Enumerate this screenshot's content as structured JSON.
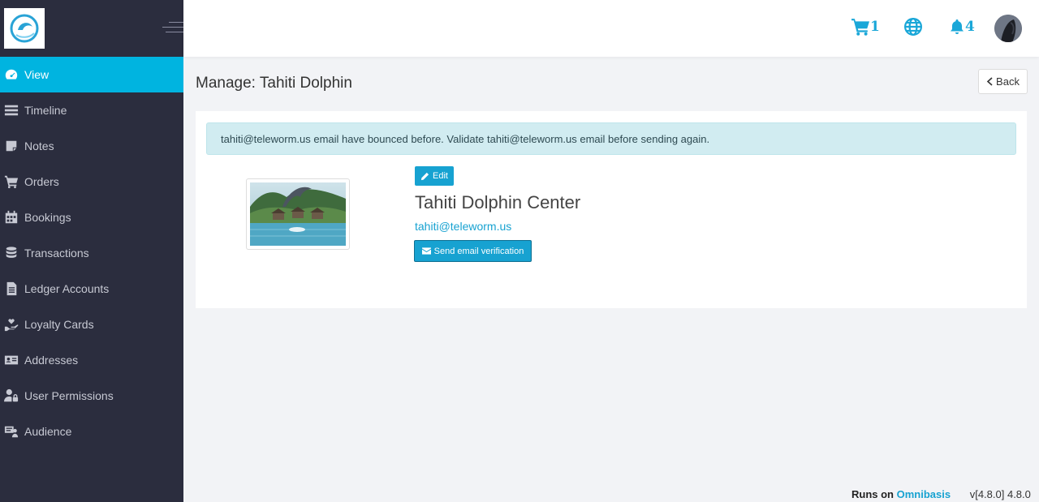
{
  "sidebar": {
    "items": [
      {
        "label": "View",
        "icon": "dashboard-gauge-icon",
        "active": true
      },
      {
        "label": "Timeline",
        "icon": "list-lines-icon"
      },
      {
        "label": "Notes",
        "icon": "sticky-note-icon"
      },
      {
        "label": "Orders",
        "icon": "shopping-cart-icon"
      },
      {
        "label": "Bookings",
        "icon": "calendar-icon"
      },
      {
        "label": "Transactions",
        "icon": "coins-stack-icon"
      },
      {
        "label": "Ledger Accounts",
        "icon": "ledger-document-icon"
      },
      {
        "label": "Loyalty Cards",
        "icon": "hand-holding-heart-icon"
      },
      {
        "label": "Addresses",
        "icon": "address-card-icon"
      },
      {
        "label": "User Permissions",
        "icon": "user-lock-icon"
      },
      {
        "label": "Audience",
        "icon": "audience-network-icon"
      }
    ]
  },
  "topbar": {
    "cart_count": "1",
    "notification_count": "4"
  },
  "main": {
    "title": "Manage: Tahiti Dolphin",
    "back_label": "Back",
    "alert": "tahiti@teleworm.us email have bounced before. Validate tahiti@teleworm.us email before sending again.",
    "edit_label": "Edit",
    "company_name": "Tahiti Dolphin Center",
    "email": "tahiti@teleworm.us",
    "verify_label": "Send email verification"
  },
  "footer": {
    "runs_on": "Runs on",
    "brand": "Omnibasis",
    "version": "v[4.8.0] 4.8.0"
  },
  "colors": {
    "accent": "#00b4e0",
    "sidebar_bg": "#2b2d3e",
    "alert_bg": "#d1ecf1"
  }
}
